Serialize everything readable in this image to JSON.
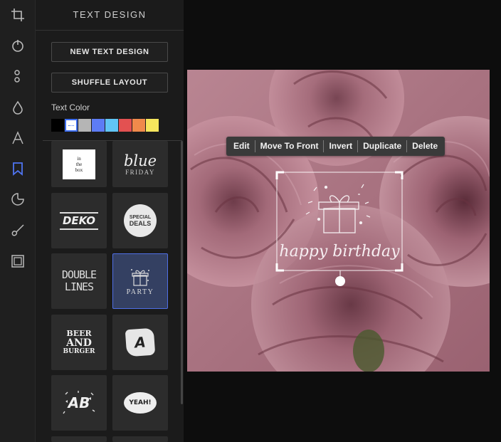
{
  "panel": {
    "title": "TEXT DESIGN",
    "new_button": "NEW TEXT DESIGN",
    "shuffle_button": "SHUFFLE LAYOUT",
    "text_color_label": "Text Color",
    "swatches": [
      "#000000",
      "#ffffff",
      "#b5b5b5",
      "#5d7cf5",
      "#61c5f5",
      "#e35151",
      "#f08a4b",
      "#f7e65d"
    ],
    "selected_swatch": "#ffffff"
  },
  "tools": [
    "crop-icon",
    "filter-icon",
    "adjust-icon",
    "drop-icon",
    "text-icon",
    "bookmark-icon",
    "sticker-icon",
    "brush-icon",
    "frame-icon"
  ],
  "tiles": {
    "inthebox": [
      "in",
      "the",
      "box"
    ],
    "blue": {
      "main": "blue",
      "sub": "FRIDAY"
    },
    "deko": "DEKO",
    "special": [
      "SPECIAL",
      "DEALS"
    ],
    "double": [
      "DOUBLE",
      "LINES"
    ],
    "party": "PARTY",
    "beer": [
      "BEER",
      "AND",
      "BURGER"
    ],
    "a_badge": "A",
    "ab": "AB",
    "yeah": "YEAH!"
  },
  "selection_toolbar": [
    "Edit",
    "Move To Front",
    "Invert",
    "Duplicate",
    "Delete"
  ],
  "canvas_text": "happy birthday"
}
